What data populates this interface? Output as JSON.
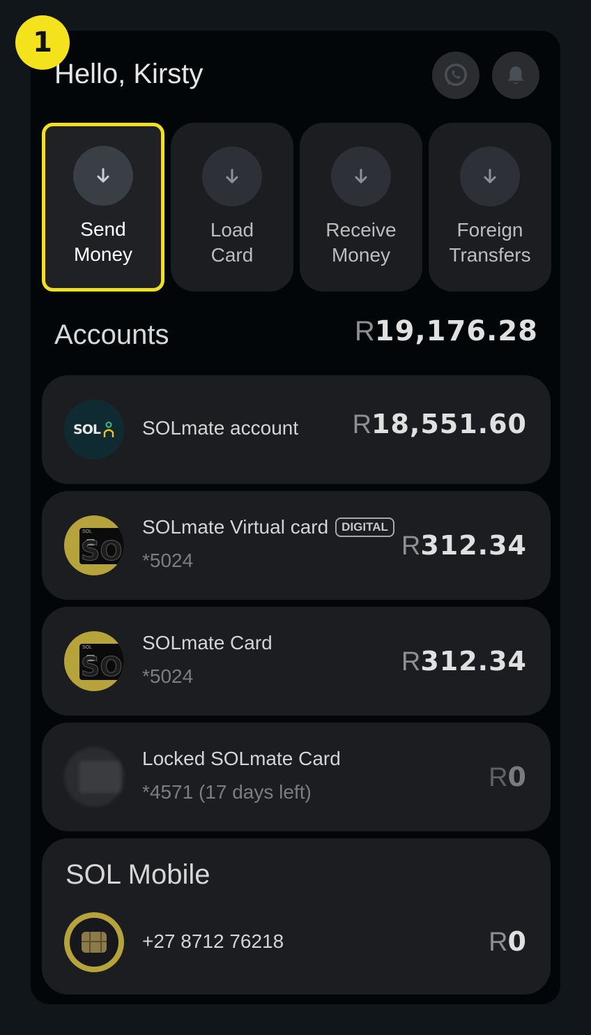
{
  "step_badge": "1",
  "greeting": "Hello, Kirsty",
  "header_icons": [
    "whatsapp-icon",
    "bell-icon"
  ],
  "actions": [
    {
      "line1": "Send",
      "line2": "Money",
      "icon": "arrow-down-icon",
      "selected": true
    },
    {
      "line1": "Load",
      "line2": "Card",
      "icon": "arrow-down-icon",
      "selected": false
    },
    {
      "line1": "Receive",
      "line2": "Money",
      "icon": "arrow-down-icon",
      "selected": false
    },
    {
      "line1": "Foreign",
      "line2": "Transfers",
      "icon": "arrow-down-icon",
      "selected": false
    }
  ],
  "accounts": {
    "title": "Accounts",
    "total_currency": "R",
    "total_amount": "19,176.28",
    "items": [
      {
        "name": "SOLmate account",
        "sub": "",
        "currency": "R",
        "amount": "18,551.60",
        "logo_text": "SOL",
        "logo_sub": "mate"
      },
      {
        "name": "SOLmate Virtual card",
        "badge": "DIGITAL",
        "sub": "*5024",
        "currency": "R",
        "amount": "312.34",
        "card_brand": "SOL"
      },
      {
        "name": "SOLmate Card",
        "sub": "*5024",
        "currency": "R",
        "amount": "312.34",
        "card_brand": "SOL"
      },
      {
        "name": "Locked SOLmate Card",
        "sub": "*4571 (17 days left)",
        "currency": "R",
        "amount": "0"
      }
    ]
  },
  "mobile": {
    "title": "SOL Mobile",
    "number": "+27 8712 76218",
    "currency": "R",
    "amount": "0"
  },
  "colors": {
    "accent_yellow": "#f2e01a",
    "gold": "#b6a33b",
    "card_bg": "#1c1d21",
    "screen_bg": "#030608"
  }
}
